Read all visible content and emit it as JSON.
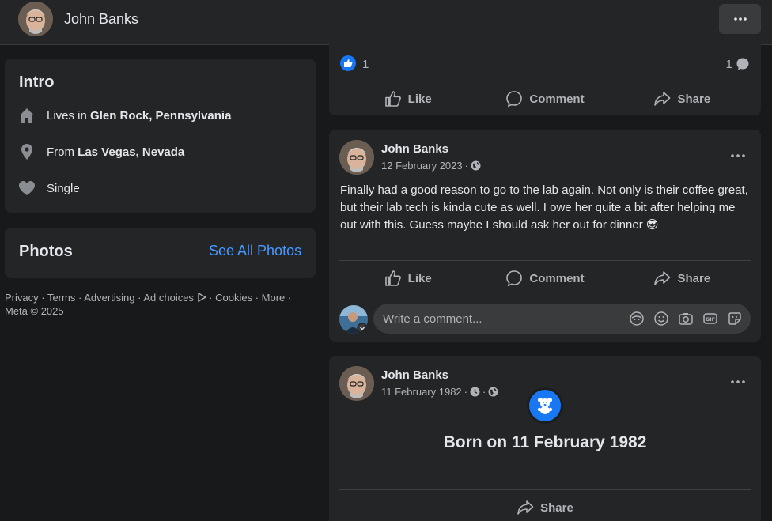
{
  "header": {
    "name": "John Banks"
  },
  "intro": {
    "title": "Intro",
    "items": [
      {
        "icon": "home-icon",
        "prefix": "Lives in",
        "value": "Glen Rock, Pennsylvania"
      },
      {
        "icon": "location-pin-icon",
        "prefix": "From",
        "value": "Las Vegas, Nevada"
      },
      {
        "icon": "heart-icon",
        "prefix": "",
        "value": "Single"
      }
    ]
  },
  "photos": {
    "title": "Photos",
    "see_all": "See All Photos"
  },
  "footer": {
    "links": [
      "Privacy",
      "Terms",
      "Advertising",
      "Ad choices",
      "Cookies",
      "More"
    ],
    "copyright": "Meta © 2025"
  },
  "posts": [
    {
      "reactions": "1",
      "comments": "1",
      "actions": [
        "Like",
        "Comment",
        "Share"
      ]
    },
    {
      "author": "John Banks",
      "date": "12 February 2023",
      "text": "Finally had a good reason to go to the lab again. Not only is their coffee great, but their lab tech is kinda cute as well. I owe her quite a bit after helping me out with this. Guess maybe I should ask her out for dinner",
      "emoji": "😎",
      "actions": [
        "Like",
        "Comment",
        "Share"
      ],
      "comment_placeholder": "Write a comment..."
    },
    {
      "author": "John Banks",
      "date": "11 February 1982",
      "life_event": "Born on 11 February 1982",
      "actions": [
        "Share"
      ]
    }
  ],
  "colors": {
    "accent": "#1877f2",
    "link": "#4599ff",
    "card": "#242526",
    "background": "#18191a"
  }
}
